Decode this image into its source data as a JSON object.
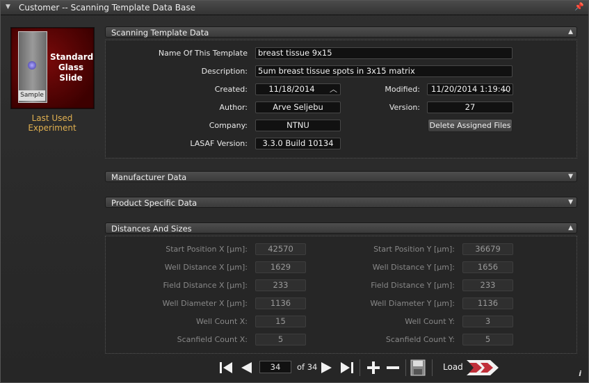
{
  "window": {
    "title": "Customer -- Scanning Template Data Base"
  },
  "thumbnail": {
    "slide_label": "Sample",
    "lines": [
      "Standard",
      "Glass",
      "Slide"
    ],
    "caption": "Last Used Experiment"
  },
  "sections": {
    "scanning": "Scanning Template Data",
    "manufacturer": "Manufacturer Data",
    "product": "Product Specific Data",
    "distances": "Distances And Sizes"
  },
  "template": {
    "name_label": "Name Of This Template",
    "name_value": "breast tissue 9x15",
    "desc_label": "Description:",
    "desc_value": "5um breast tissue spots in 3x15 matrix",
    "created_label": "Created:",
    "created_value": "11/18/2014",
    "modified_label": "Modified:",
    "modified_value": "11/20/2014 1:19:40",
    "author_label": "Author:",
    "author_value": "Arve Seljebu",
    "version_label": "Version:",
    "version_value": "27",
    "company_label": "Company:",
    "company_value": "NTNU",
    "delete_button": "Delete Assigned Files",
    "lasaf_label": "LASAF Version:",
    "lasaf_value": "3.3.0 Build 10134"
  },
  "distances": {
    "left": [
      {
        "label": "Start Position X [µm]:",
        "value": "42570"
      },
      {
        "label": "Well Distance X [µm]:",
        "value": "1629"
      },
      {
        "label": "Field Distance X [µm]:",
        "value": "233"
      },
      {
        "label": "Well Diameter X [µm]:",
        "value": "1136"
      },
      {
        "label": "Well Count X:",
        "value": "15"
      },
      {
        "label": "Scanfield Count X:",
        "value": "5"
      }
    ],
    "right": [
      {
        "label": "Start Position Y [µm]:",
        "value": "36679"
      },
      {
        "label": "Well Distance Y [µm]:",
        "value": "1656"
      },
      {
        "label": "Field Distance Y [µm]:",
        "value": "233"
      },
      {
        "label": "Well Diameter Y [µm]:",
        "value": "1136"
      },
      {
        "label": "Well Count Y:",
        "value": "3"
      },
      {
        "label": "Scanfield Count Y:",
        "value": "5"
      }
    ]
  },
  "pager": {
    "current": "34",
    "of_text": "of 34",
    "load_label": "Load"
  },
  "icons": [
    "collapse-icon",
    "pin-icon",
    "first-page-icon",
    "prev-page-icon",
    "next-page-icon",
    "last-page-icon",
    "add-icon",
    "remove-icon",
    "save-icon",
    "load-arrow-icon",
    "info-icon"
  ]
}
